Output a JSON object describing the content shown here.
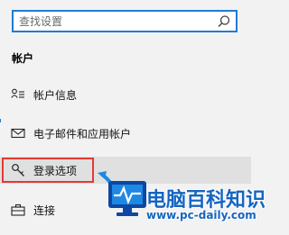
{
  "search": {
    "placeholder": "查找设置",
    "icon": "search-icon"
  },
  "section": {
    "title": "帐户"
  },
  "items": [
    {
      "label": "帐户信息",
      "icon": "person-list-icon"
    },
    {
      "label": "电子邮件和应用帐户",
      "icon": "mail-icon"
    },
    {
      "label": "登录选项",
      "icon": "key-icon",
      "selected": true
    },
    {
      "label": "连接",
      "icon": "briefcase-icon"
    }
  ],
  "watermark": {
    "title": "电脑百科知识",
    "url": "www.pc-daily.com"
  },
  "colors": {
    "accent": "#1f7cd6",
    "highlight_border": "#e53935",
    "watermark": "#1565c0",
    "background": "#f2f2f2"
  }
}
